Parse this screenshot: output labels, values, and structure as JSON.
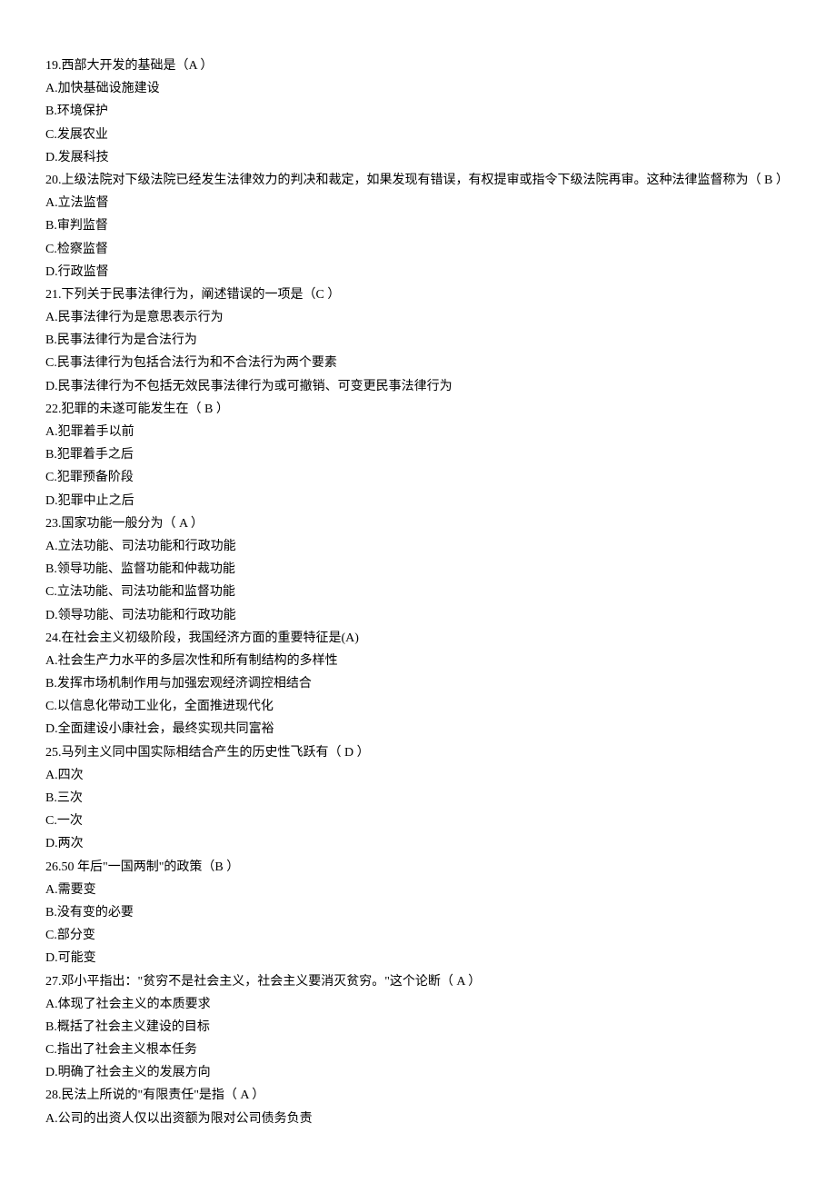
{
  "lines": [
    "19.西部大开发的基础是（A ）",
    "A.加快基础设施建设",
    "B.环境保护",
    "C.发展农业",
    "D.发展科技",
    "20.上级法院对下级法院已经发生法律效力的判决和裁定，如果发现有错误，有权提审或指令下级法院再审。这种法律监督称为（ B ）",
    "A.立法监督",
    "B.审判监督",
    "C.检察监督",
    "D.行政监督",
    "21.下列关于民事法律行为，阐述错误的一项是（C ）",
    "A.民事法律行为是意思表示行为",
    "B.民事法律行为是合法行为",
    "C.民事法律行为包括合法行为和不合法行为两个要素",
    "D.民事法律行为不包括无效民事法律行为或可撤销、可变更民事法律行为",
    "22.犯罪的未遂可能发生在（ B ）",
    "A.犯罪着手以前",
    "B.犯罪着手之后",
    "C.犯罪预备阶段",
    "D.犯罪中止之后",
    "23.国家功能一般分为（ A ）",
    "A.立法功能、司法功能和行政功能",
    "B.领导功能、监督功能和仲裁功能",
    "C.立法功能、司法功能和监督功能",
    "D.领导功能、司法功能和行政功能",
    "24.在社会主义初级阶段，我国经济方面的重要特征是(A)",
    "A.社会生产力水平的多层次性和所有制结构的多样性",
    "B.发挥市场机制作用与加强宏观经济调控相结合",
    "C.以信息化带动工业化，全面推进现代化",
    "D.全面建设小康社会，最终实现共同富裕",
    "25.马列主义同中国实际相结合产生的历史性飞跃有（ D ）",
    "A.四次",
    "B.三次",
    "C.一次",
    "D.两次",
    "26.50 年后\"一国两制\"的政策（B ）",
    "A.需要变",
    "B.没有变的必要",
    "C.部分变",
    "D.可能变",
    "27.邓小平指出：\"贫穷不是社会主义，社会主义要消灭贫穷。\"这个论断（ A ）",
    "A.体现了社会主义的本质要求",
    "B.概括了社会主义建设的目标",
    "C.指出了社会主义根本任务",
    "D.明确了社会主义的发展方向",
    "28.民法上所说的\"有限责任\"是指（ A ）",
    "A.公司的出资人仅以出资额为限对公司债务负责"
  ]
}
